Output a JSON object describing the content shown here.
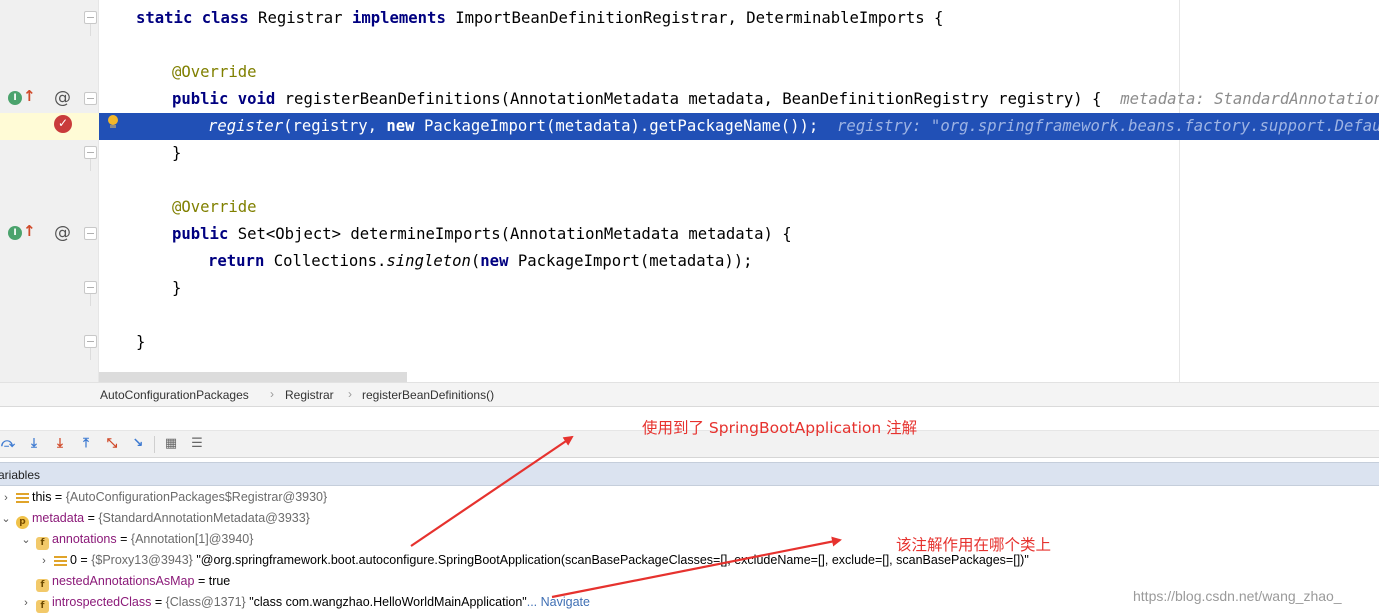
{
  "editor": {
    "line1": {
      "kw1": "static class",
      "name": " Registrar ",
      "kw2": "implements",
      "rest": " ImportBeanDefinitionRegistrar, DeterminableImports {"
    },
    "line3": {
      "ann": "@Override"
    },
    "line4": {
      "kw": "public void",
      "rest": " registerBeanDefinitions(AnnotationMetadata metadata, BeanDefinitionRegistry registry) {",
      "hint": "  metadata: StandardAnnotationMetad"
    },
    "line5": {
      "call": "register",
      "mid": "(registry, ",
      "kw": "new",
      "rest": " PackageImport(metadata).getPackageName());",
      "hint": "  registry: \"org.springframework.beans.factory.support.DefaultLis"
    },
    "line6": {
      "text": "}"
    },
    "line8": {
      "ann": "@Override"
    },
    "line9": {
      "kw": "public",
      "rest": " Set<Object> determineImports(AnnotationMetadata metadata) {"
    },
    "line10": {
      "kw": "return",
      "mid": " Collections.",
      "call": "singleton",
      "open": "(",
      "kw2": "new",
      "rest": " PackageImport(metadata));"
    },
    "line11": {
      "text": "}"
    },
    "line13": {
      "text": "}"
    },
    "gutter": {
      "impl_glyph": "I",
      "impl_arrow": "↑",
      "at_glyph": "@"
    }
  },
  "breadcrumb": {
    "items": [
      "AutoConfigurationPackages",
      "Registrar",
      "registerBeanDefinitions()"
    ],
    "separator": "›"
  },
  "toolbar": {
    "buttons": [
      "step-over",
      "step-into",
      "force-step-into",
      "step-out",
      "drop-frame",
      "run-to-cursor",
      "evaluate-expression",
      "trace-current-stream"
    ]
  },
  "variables": {
    "title": "ariables",
    "rows": [
      {
        "chev": "›",
        "icon": "list",
        "name": "this",
        "eq": " = ",
        "type": "{AutoConfigurationPackages$Registrar@3930}",
        "value": ""
      },
      {
        "chev": "⌄",
        "icon": "p",
        "icon_text": "p",
        "name": "metadata",
        "eq": " = ",
        "type": "{StandardAnnotationMetadata@3933}",
        "value": ""
      },
      {
        "chev": "⌄",
        "icon": "f",
        "icon_text": "f",
        "name": "annotations",
        "eq": " = ",
        "type": "{Annotation[1]@3940}",
        "value": ""
      },
      {
        "chev": "›",
        "icon": "list",
        "name": "0",
        "eq": " = ",
        "type": "{$Proxy13@3943}",
        "value": " \"@org.springframework.boot.autoconfigure.SpringBootApplication(scanBasePackageClasses=[], excludeName=[], exclude=[], scanBasePackages=[])\""
      },
      {
        "chev": "",
        "icon": "f",
        "icon_text": "f",
        "name": "nestedAnnotationsAsMap",
        "eq": " = ",
        "type": "",
        "value": "true"
      },
      {
        "chev": "›",
        "icon": "f",
        "icon_text": "f",
        "name": "introspectedClass",
        "eq": " = ",
        "type": "{Class@1371}",
        "value": " \"class com.wangzhao.HelloWorldMainApplication\"",
        "nav": "... Navigate"
      }
    ]
  },
  "annotations": {
    "note1": "使用到了 SpringBootApplication 注解",
    "note2": "该注解作用在哪个类上",
    "color": "#e6322e"
  },
  "watermark": "https://blog.csdn.net/wang_zhao_",
  "colors": {
    "selection": "#2150b6",
    "keyword": "#000080",
    "annotation": "#808000",
    "field_name": "#8b1a79"
  }
}
